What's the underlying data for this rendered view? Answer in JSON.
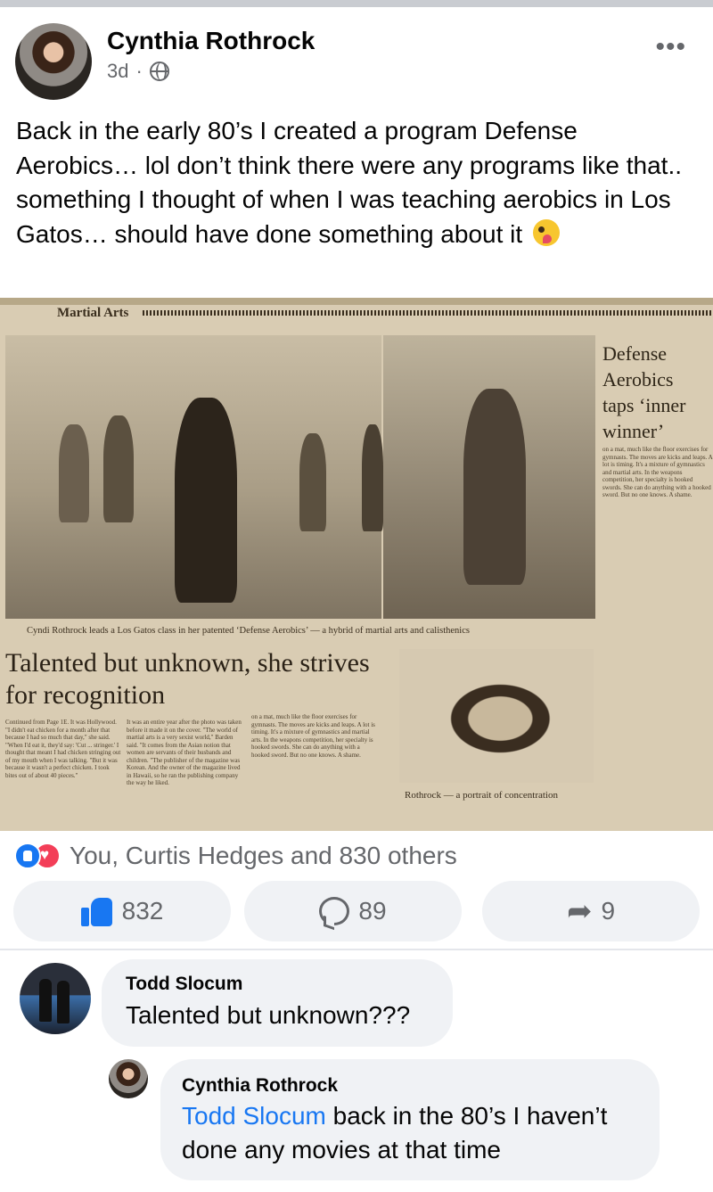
{
  "post": {
    "author": "Cynthia Rothrock",
    "time": "3d",
    "separator": "·",
    "privacy_icon": "globe-icon",
    "more_icon": "…",
    "text": "Back in the early 80’s I created a program Defense Aerobics… lol don’t think there were any programs like that.. something I thought of when I was teaching aerobics in Los Gatos… should have done something about it",
    "emoji": "zany-face-emoji"
  },
  "article": {
    "section": "Martial Arts",
    "title_lines": [
      "Defense",
      "Aerobics",
      "taps ‘inner",
      "winner’"
    ],
    "photo_caption": "Cyndi Rothrock leads a Los Gatos class in her patented ‘Defense Aerobics’ — a hybrid of martial arts and calisthenics",
    "headline": "Talented but unknown, she strives for recognition",
    "portrait_caption": "Rothrock — a portrait of concentration",
    "col1": "Continued from Page 1E. It was Hollywood. \"I didn't eat chicken for a month after that because I had so much that day,\" she said. \"When I'd eat it, they'd say: 'Cut ... stringer.' I thought that meant I had chicken stringing out of my mouth when I was talking. \"But it was because it wasn't a perfect chicken. I took bites out of about 40 pieces.\"",
    "col2": "It was an entire year after the photo was taken before it made it on the cover. \"The world of martial arts is a very sexist world,\" Barden said. \"It comes from the Asian notion that women are servants of their husbands and children. \"The publisher of the magazine was Korean. And the owner of the magazine lived in Hawaii, so he ran the publishing company the way he liked.",
    "col3": "on a mat, much like the floor exercises for gymnasts. The moves are kicks and leaps. A lot is timing. It's a mixture of gymnastics and martial arts. In the weapons competition, her specialty is hooked swords. She can do anything with a hooked sword. But no one knows. A shame."
  },
  "reactions": {
    "summary": "You, Curtis Hedges and 830 others"
  },
  "actions": {
    "like_count": "832",
    "comment_count": "89",
    "share_count": "9"
  },
  "comments": [
    {
      "author": "Todd Slocum",
      "text": "Talented but unknown???"
    },
    {
      "author": "Cynthia Rothrock",
      "mention": "Todd Slocum",
      "text": "back in the 80’s I haven’t done any movies at that time"
    }
  ]
}
